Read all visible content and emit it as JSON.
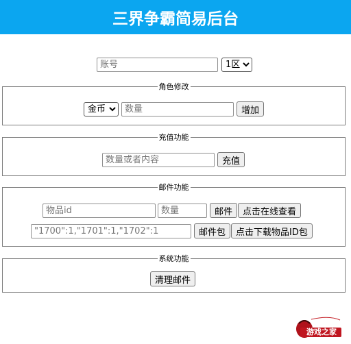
{
  "header": {
    "title": "三界争霸简易后台"
  },
  "account": {
    "placeholder": "账号",
    "zone_selected": "1区"
  },
  "role_section": {
    "legend": "角色修改",
    "item_selected": "金币",
    "amount_placeholder": "数量",
    "add_label": "增加"
  },
  "recharge_section": {
    "legend": "充值功能",
    "input_placeholder": "数量或者内容",
    "recharge_label": "充值"
  },
  "mail_section": {
    "legend": "邮件功能",
    "item_id_placeholder": "物品id",
    "amount_placeholder": "数量",
    "mail_label": "邮件",
    "view_online_label": "点击在线查看",
    "package_placeholder": "\"1700\":1,\"1701\":1,\"1702\":1",
    "mail_package_label": "邮件包",
    "download_ids_label": "点击下载物品ID包"
  },
  "system_section": {
    "legend": "系统功能",
    "clear_mail_label": "清理邮件"
  },
  "watermark": {
    "logo_text": "游戏之家"
  }
}
